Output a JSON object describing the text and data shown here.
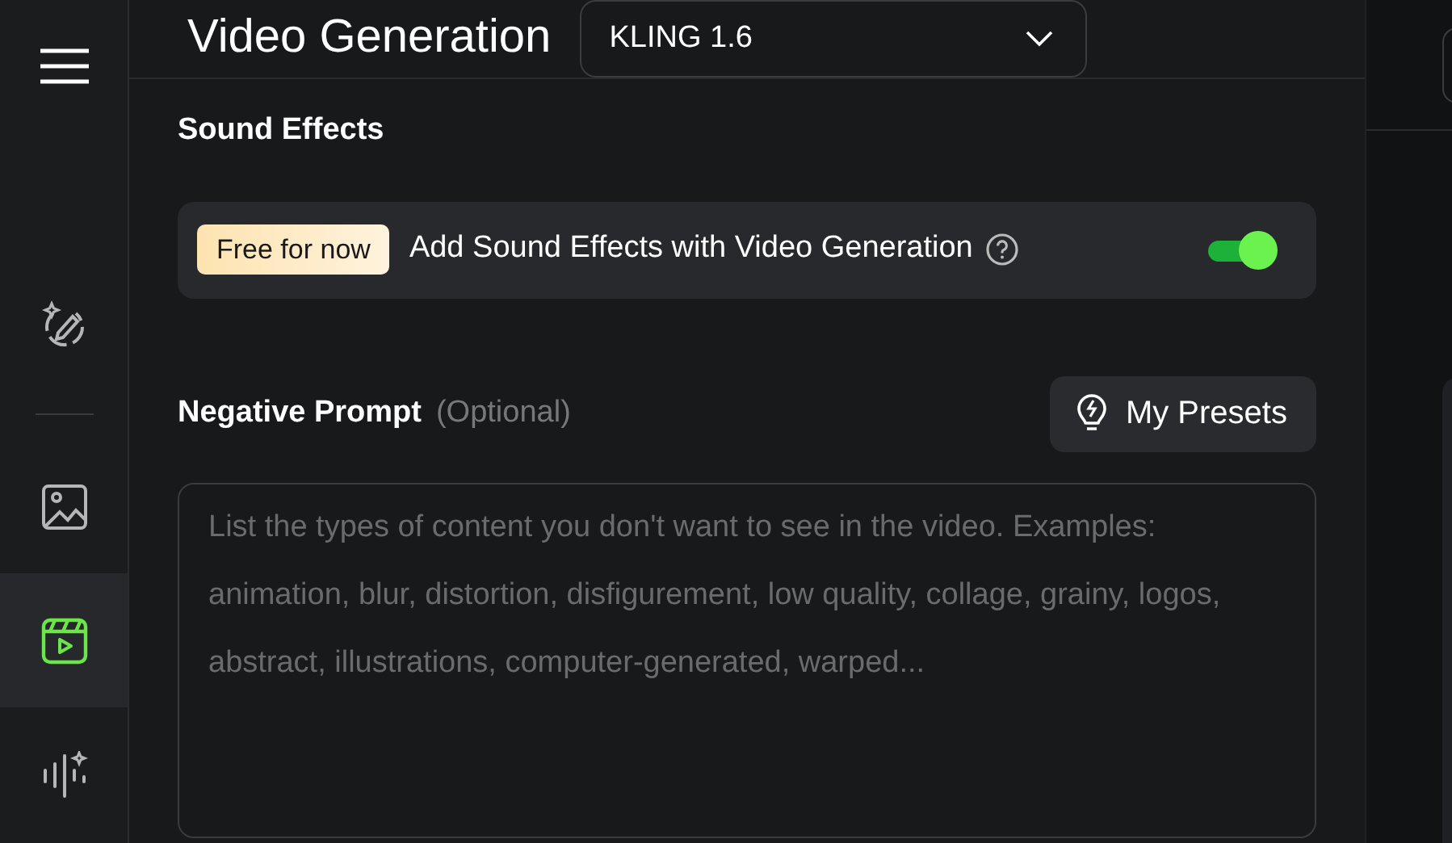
{
  "sidebar": {
    "items": [
      {
        "kind": "magic",
        "selected": false
      },
      {
        "kind": "image",
        "selected": false
      },
      {
        "kind": "video",
        "selected": true
      },
      {
        "kind": "audio",
        "selected": false
      }
    ]
  },
  "header": {
    "title": "Video Generation",
    "model": "KLING 1.6"
  },
  "sound_effects": {
    "heading": "Sound Effects",
    "badge": "Free for now",
    "label": "Add Sound Effects with Video Generation",
    "on": true
  },
  "negative_prompt": {
    "heading": "Negative Prompt",
    "hint": "(Optional)",
    "presets_button": "My Presets",
    "placeholder": "List the types of content you don't want to see in the video. Examples: animation, blur, distortion, disfigurement, low quality, collage, grainy, logos, abstract, illustrations, computer-generated, warped..."
  }
}
